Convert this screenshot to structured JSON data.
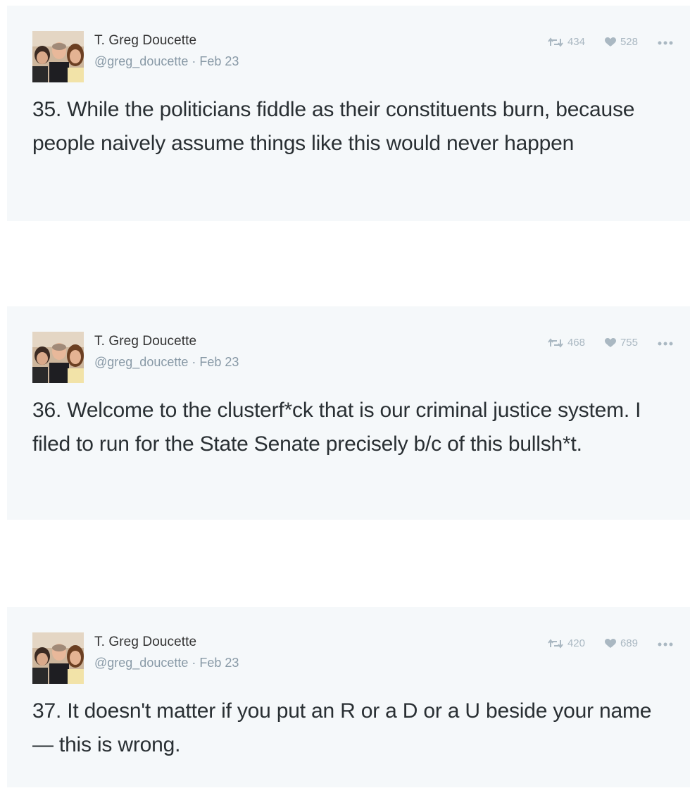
{
  "tweets": [
    {
      "author": {
        "name": "T. Greg Doucette",
        "handle": "@greg_doucette"
      },
      "date": "Feb 23",
      "text": "35. While the politicians fiddle as their constituents burn, because people naively assume things like this would never happen",
      "retweets": "434",
      "likes": "528"
    },
    {
      "author": {
        "name": "T. Greg Doucette",
        "handle": "@greg_doucette"
      },
      "date": "Feb 23",
      "text": "36. Welcome to the clusterf*ck that is our criminal justice system. I filed to run for the State Senate precisely b/c of this bullsh*t.",
      "retweets": "468",
      "likes": "755"
    },
    {
      "author": {
        "name": "T. Greg Doucette",
        "handle": "@greg_doucette"
      },
      "date": "Feb 23",
      "text": "37. It doesn't matter if you put an R or a D or a U beside your name — this is wrong.",
      "retweets": "420",
      "likes": "689"
    }
  ],
  "icons": {
    "retweet": "retweet-icon",
    "like": "heart-icon",
    "more": "ellipsis-icon"
  },
  "colors": {
    "card_background": "#f5f8fa",
    "text": "#292f33",
    "muted": "#8899a6",
    "action": "#aab8c2"
  }
}
